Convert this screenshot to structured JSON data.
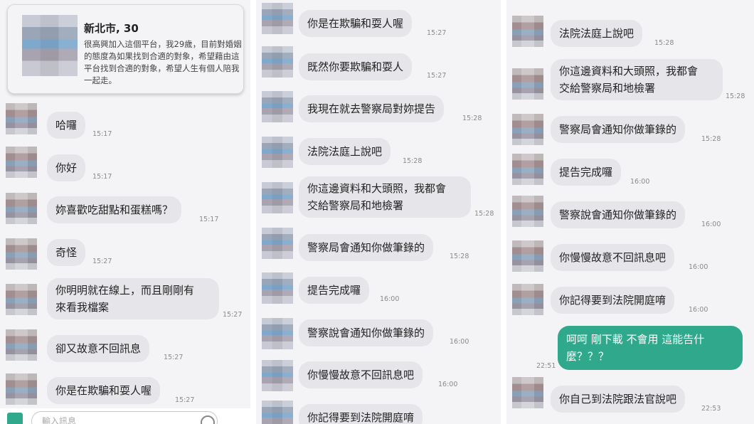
{
  "profile": {
    "name": "新北市, 30",
    "bio": "很高興加入這個平台，我29歲，目前對婚姻的態度為如果找到合適的對象，希望藉由這平台找到合適的對象，希望人生有個人陪我一起走。"
  },
  "panel1": {
    "messages": [
      {
        "text": "哈囉",
        "time": "15:17"
      },
      {
        "text": "你好",
        "time": "15:17"
      },
      {
        "text": "妳喜歡吃甜點和蛋糕嗎？",
        "time": "15:17"
      },
      {
        "text": "奇怪",
        "time": "15:27"
      },
      {
        "line1": "你明明就在線上，而且剛剛有",
        "line2": "來看我檔案",
        "time": "15:27"
      },
      {
        "text": "卻又故意不回訊息",
        "time": "15:27"
      },
      {
        "text": "你是在欺騙和耍人喔",
        "time": "15:27"
      }
    ],
    "input_placeholder": "輸入訊息"
  },
  "panel2": {
    "messages": [
      {
        "text": "你是在欺騙和耍人喔",
        "time": "15:27"
      },
      {
        "text": "既然你要欺騙和耍人",
        "time": "15:27"
      },
      {
        "text": "我現在就去警察局對妳提告",
        "time": "15:28"
      },
      {
        "text": "法院法庭上說吧",
        "time": "15:28"
      },
      {
        "line1": "你這邊資料和大頭照，我都會",
        "line2": "交給警察局和地檢署",
        "time": "15:28"
      },
      {
        "text": "警察局會通知你做筆錄的",
        "time": "15:28"
      },
      {
        "text": "提告完成囉",
        "time": "16:00"
      },
      {
        "text": "警察說會通知你做筆錄的",
        "time": "16:00"
      },
      {
        "text": "你慢慢故意不回訊息吧",
        "time": "16:00"
      },
      {
        "text": "你記得要到法院開庭唷",
        "time": ""
      }
    ]
  },
  "panel3": {
    "messages": [
      {
        "text": "法院法庭上說吧",
        "time": "15:28"
      },
      {
        "line1": "你這邊資料和大頭照，我都會",
        "line2": "交給警察局和地檢署",
        "time": "15:28"
      },
      {
        "text": "警察局會通知你做筆錄的",
        "time": "15:28"
      },
      {
        "text": "提告完成囉",
        "time": "16:00"
      },
      {
        "text": "警察說會通知你做筆錄的",
        "time": "16:00"
      },
      {
        "text": "你慢慢故意不回訊息吧",
        "time": "16:00"
      },
      {
        "text": "你記得要到法院開庭唷",
        "time": "16:00"
      },
      {
        "text": "你自己到法院跟法官說吧",
        "time": "22:53"
      }
    ],
    "sent": {
      "line1": "呵呵 剛下載 不會用 這能告什",
      "line2": "麼？？？",
      "time": "22:51"
    }
  },
  "colors": {
    "incoming_bubble": "#e6e6ea",
    "outgoing_bubble": "#2fa88b",
    "panel_bg": "#f4f4f6"
  }
}
